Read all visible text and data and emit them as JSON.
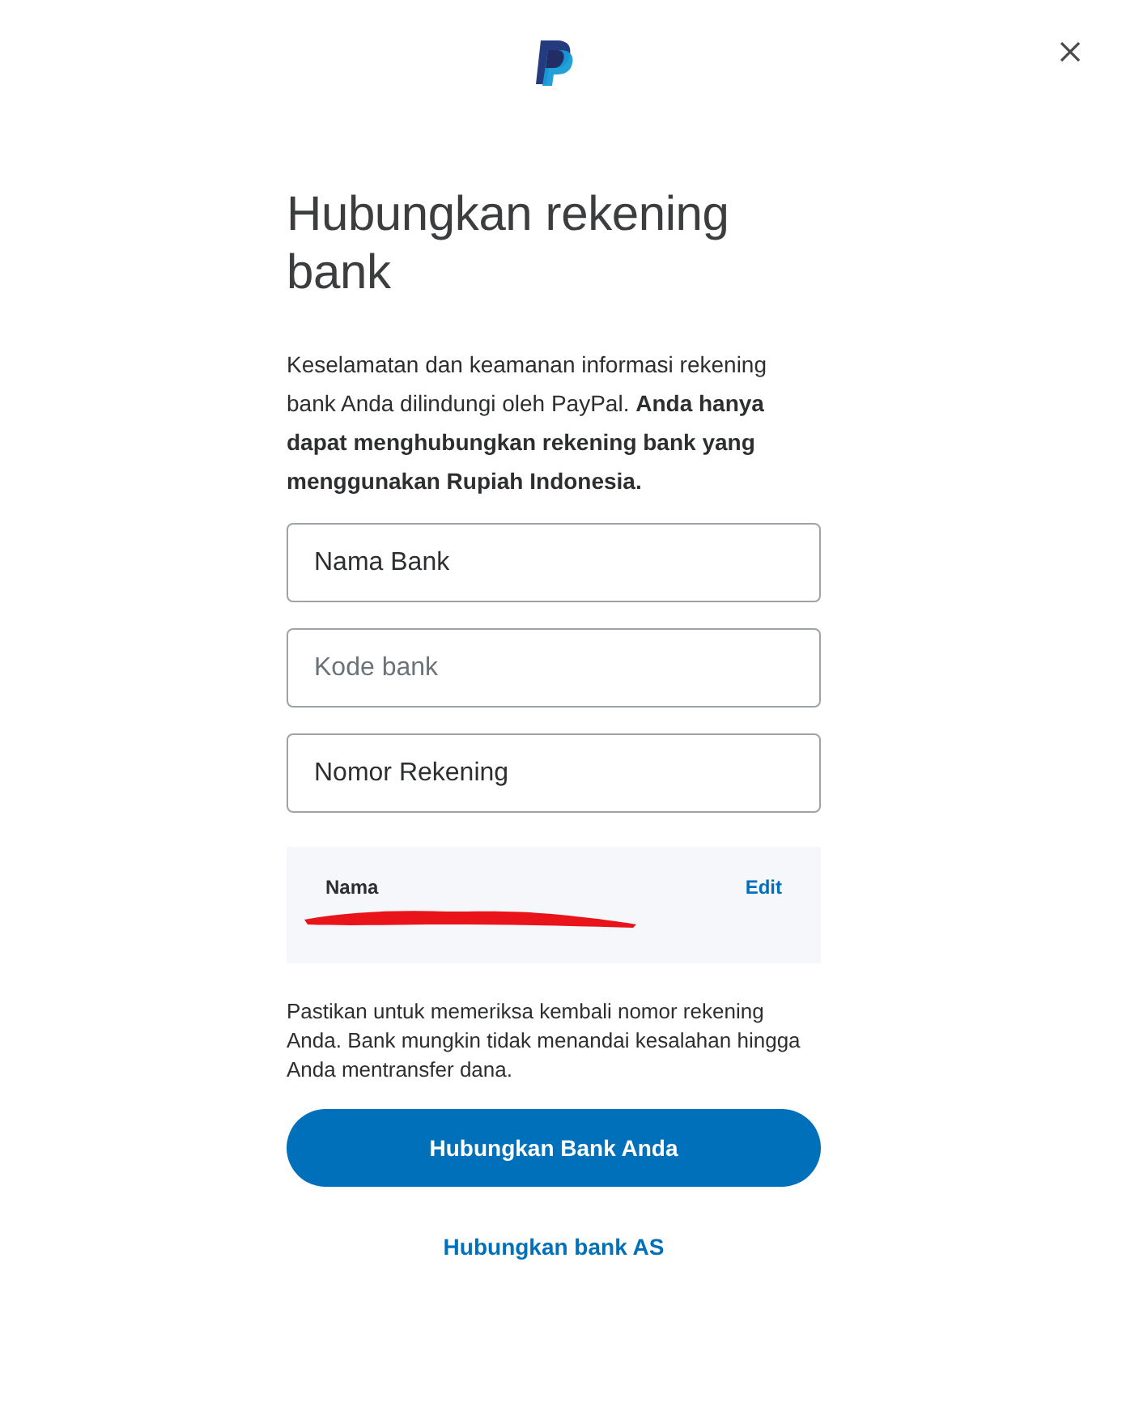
{
  "title": "Hubungkan rekening bank",
  "intro": "Keselamatan dan keamanan informasi rekening bank Anda dilindungi oleh PayPal. **Anda hanya dapat menghubungkan rekening bank yang menggunakan Rupiah Indonesia.**",
  "fields": [
    {
      "value": "Nama Bank"
    },
    {
      "placeholder": "Kode bank"
    },
    {
      "value": "Nomor Rekening"
    }
  ],
  "name_card": {
    "label": "Nama",
    "action": "Edit",
    "value_redacted": true
  },
  "notice": "Pastikan untuk memeriksa kembali nomor rekening Anda. Bank mungkin tidak menandai kesalahan hingga Anda mentransfer dana.",
  "primary_button": "Hubungkan Bank Anda",
  "secondary_link": "Hubungkan bank AS"
}
